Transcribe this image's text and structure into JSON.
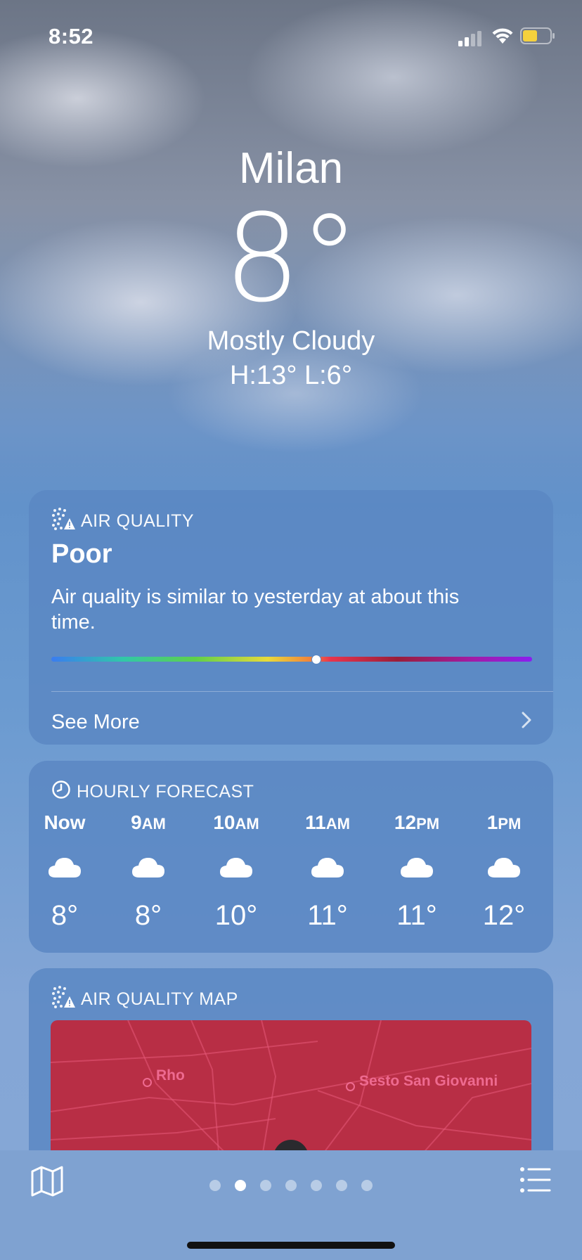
{
  "status_bar": {
    "time": "8:52"
  },
  "location": {
    "city": "Milan",
    "temperature": "8°",
    "condition": "Mostly Cloudy",
    "high_low": "H:13°  L:6°"
  },
  "air_quality": {
    "title": "AIR QUALITY",
    "level": "Poor",
    "description": "Air quality is similar to yesterday at about this time.",
    "indicator_fraction": 0.55,
    "see_more": "See More"
  },
  "hourly": {
    "title": "HOURLY FORECAST",
    "hours": [
      {
        "h": "Now",
        "sfx": "",
        "temp": "8°",
        "icon": "cloud-icon"
      },
      {
        "h": "9",
        "sfx": "AM",
        "temp": "8°",
        "icon": "cloud-icon"
      },
      {
        "h": "10",
        "sfx": "AM",
        "temp": "10°",
        "icon": "cloud-icon"
      },
      {
        "h": "11",
        "sfx": "AM",
        "temp": "11°",
        "icon": "cloud-icon"
      },
      {
        "h": "12",
        "sfx": "PM",
        "temp": "11°",
        "icon": "cloud-icon"
      },
      {
        "h": "1",
        "sfx": "PM",
        "temp": "12°",
        "icon": "cloud-icon"
      }
    ]
  },
  "aq_map": {
    "title": "AIR QUALITY MAP",
    "places": [
      "Rho",
      "Sesto San Giovanni"
    ]
  },
  "bottom_bar": {
    "pages": 7,
    "active_page": 1
  },
  "colors": {
    "accent_white": "#ffffff",
    "card_bg": "#5a87c3",
    "map_red": "#b82e45"
  }
}
